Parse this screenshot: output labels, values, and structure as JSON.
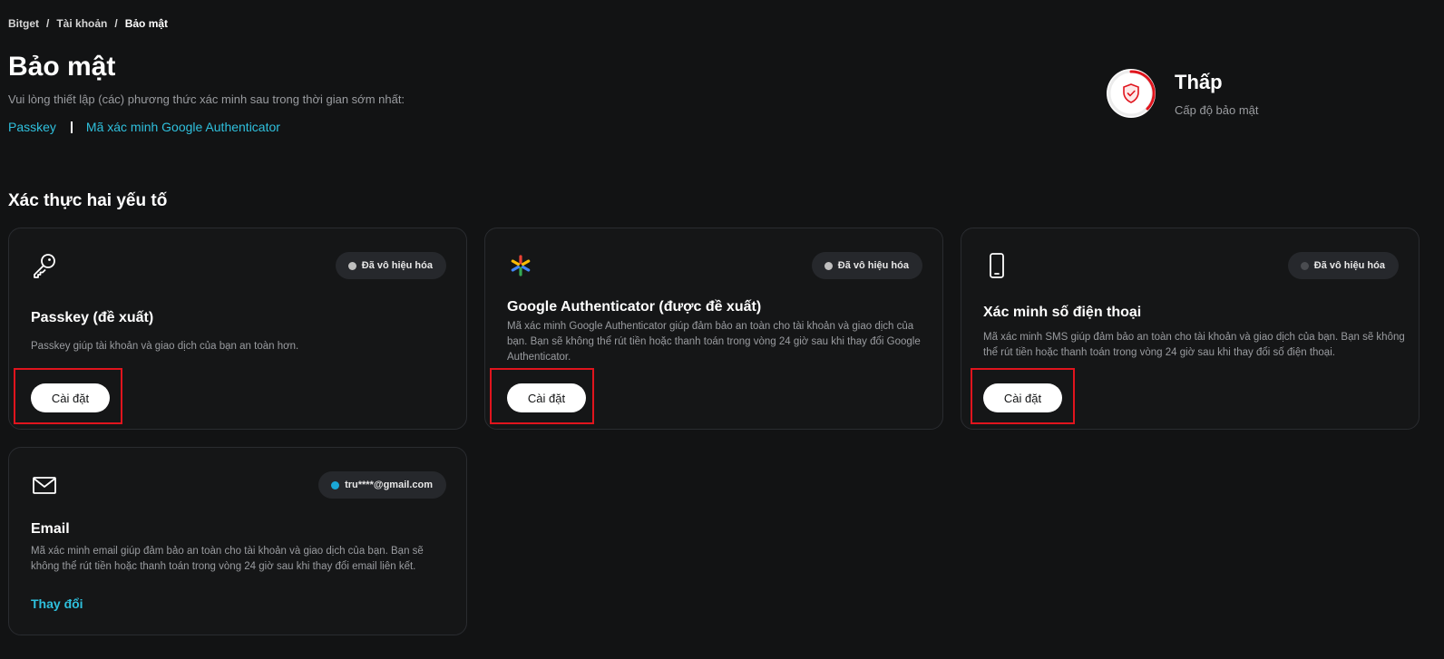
{
  "breadcrumb": {
    "items": [
      "Bitget",
      "Tài khoản",
      "Bảo mật"
    ],
    "separator": "/"
  },
  "page": {
    "title": "Bảo mật",
    "subtitle": "Vui lòng thiết lập (các) phương thức xác minh sau trong thời gian sớm nhất:",
    "links": [
      "Passkey",
      "Mã xác minh Google Authenticator"
    ]
  },
  "security_level": {
    "level": "Thấp",
    "label": "Cấp độ bảo mật",
    "icon": "shield-icon",
    "accent": "#e0141d"
  },
  "section": {
    "title": "Xác thực hai yếu tố"
  },
  "cards": {
    "passkey": {
      "icon": "key-icon",
      "status": "Đã vô hiệu hóa",
      "title": "Passkey (đề xuất)",
      "desc": "Passkey giúp tài khoản và giao dịch của bạn an toàn hơn.",
      "button": "Cài đặt"
    },
    "google": {
      "icon": "google-authenticator-icon",
      "status": "Đã vô hiệu hóa",
      "title": "Google Authenticator (được đề xuất)",
      "desc": "Mã xác minh Google Authenticator giúp đảm bảo an toàn cho tài khoản và giao dịch của bạn. Bạn sẽ không thể rút tiền hoặc thanh toán trong vòng 24 giờ sau khi thay đổi Google Authenticator.",
      "button": "Cài đặt"
    },
    "phone": {
      "icon": "phone-icon",
      "status": "Đã vô hiệu hóa",
      "title": "Xác minh số điện thoại",
      "desc": "Mã xác minh SMS giúp đảm bảo an toàn cho tài khoản và giao dịch của bạn. Bạn sẽ không thể rút tiền hoặc thanh toán trong vòng 24 giờ sau khi thay đổi số điện thoại.",
      "button": "Cài đặt"
    },
    "email": {
      "icon": "mail-icon",
      "status": "tru****@gmail.com",
      "title": "Email",
      "desc": "Mã xác minh email giúp đảm bảo an toàn cho tài khoản và giao dịch của bạn. Bạn sẽ không thể rút tiền hoặc thanh toán trong vòng 24 giờ sau khi thay đổi email liên kết.",
      "link": "Thay đổi"
    }
  },
  "colors": {
    "background": "#121314",
    "link": "#2fc0dd",
    "highlight": "#e0141d",
    "status_disabled": "#bfbfbf",
    "status_active": "#1aa7d6"
  }
}
